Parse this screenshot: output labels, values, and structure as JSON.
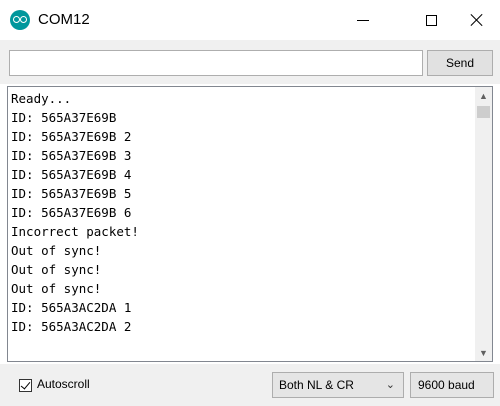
{
  "window": {
    "title": "COM12",
    "app_icon": "arduino-logo-icon",
    "minimize_icon": "minimize-icon",
    "maximize_icon": "maximize-icon",
    "close_icon": "close-icon"
  },
  "input_row": {
    "input_value": "",
    "send_label": "Send"
  },
  "output": {
    "lines": [
      "Ready...",
      "ID: 565A37E69B",
      "ID: 565A37E69B 2",
      "ID: 565A37E69B 3",
      "ID: 565A37E69B 4",
      "ID: 565A37E69B 5",
      "ID: 565A37E69B 6",
      "Incorrect packet!",
      "Out of sync!",
      "Out of sync!",
      "Out of sync!",
      "ID: 565A3AC2DA 1",
      "ID: 565A3AC2DA 2"
    ]
  },
  "statusbar": {
    "autoscroll_label": "Autoscroll",
    "autoscroll_checked": true,
    "line_ending": "Both NL & CR",
    "baud_rate": "9600 baud"
  },
  "colors": {
    "accent": "#00979c"
  }
}
